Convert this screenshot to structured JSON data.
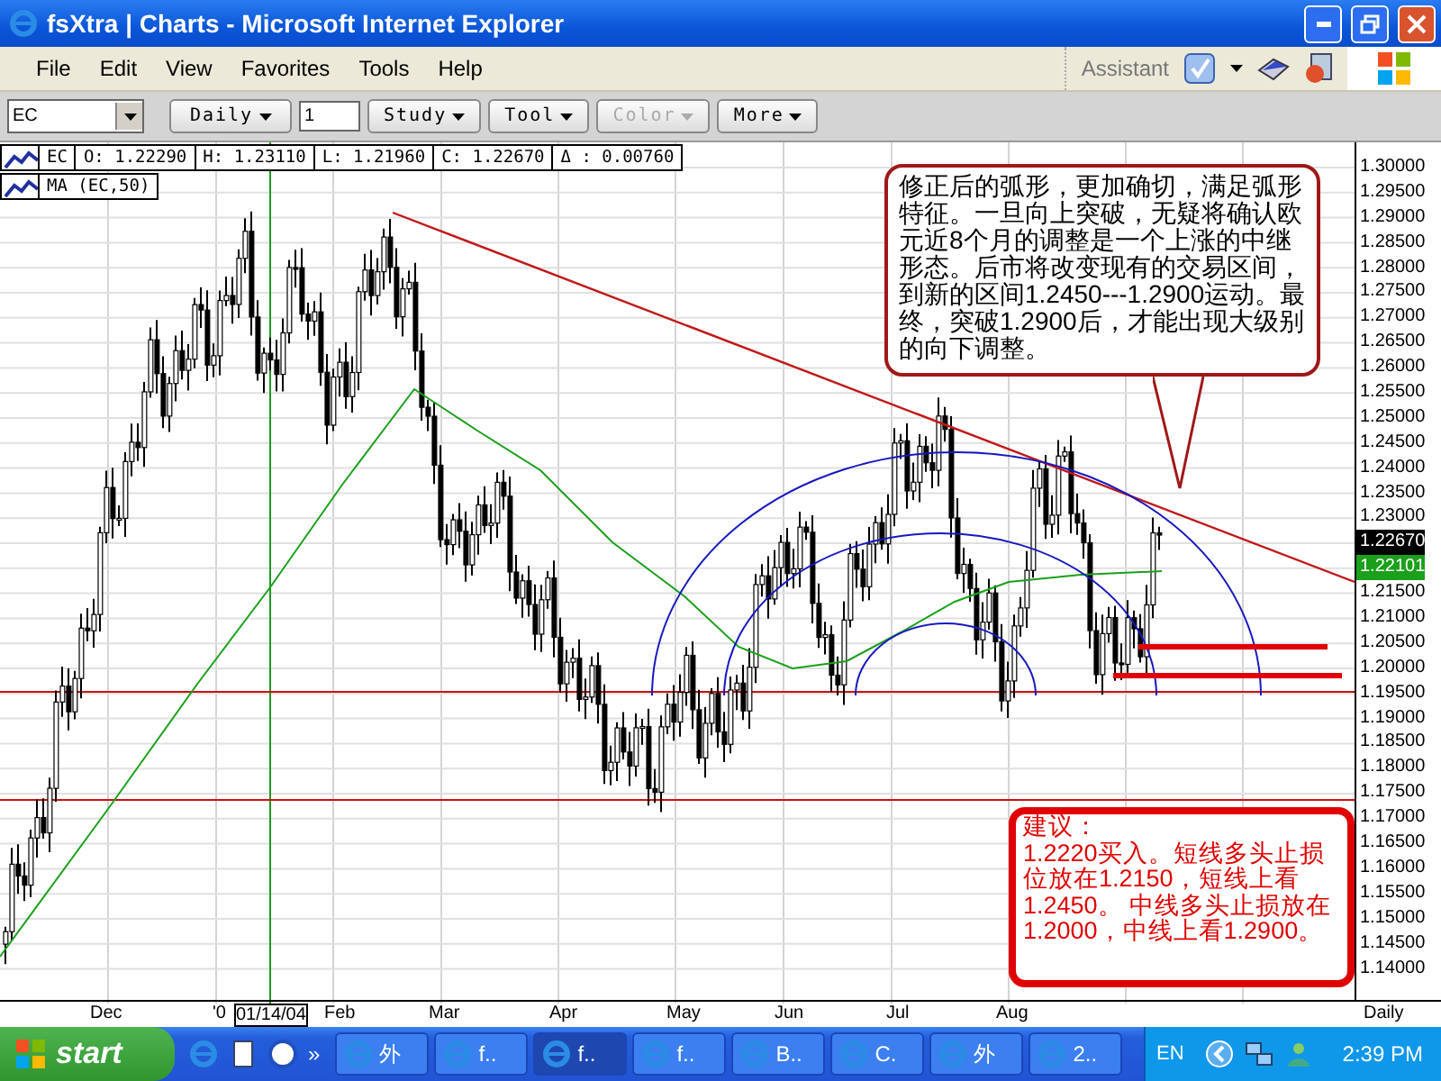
{
  "window": {
    "title": "fsXtra | Charts - Microsoft Internet Explorer"
  },
  "menu": [
    "File",
    "Edit",
    "View",
    "Favorites",
    "Tools",
    "Help"
  ],
  "assistant": {
    "label": "Assistant"
  },
  "toolbar": {
    "symbol": "EC",
    "items": [
      {
        "kind": "dropdown",
        "label": "Daily",
        "disabled": false
      },
      {
        "kind": "input",
        "value": "1"
      },
      {
        "kind": "dropdown",
        "label": "Study",
        "disabled": false
      },
      {
        "kind": "dropdown",
        "label": "Tool",
        "disabled": false
      },
      {
        "kind": "dropdown",
        "label": "Color",
        "disabled": true
      },
      {
        "kind": "dropdown",
        "label": "More",
        "disabled": false
      }
    ]
  },
  "legend": {
    "symbol": "EC",
    "fields": [
      "O: 1.22290",
      "H: 1.23110",
      "L: 1.21960",
      "C: 1.22670",
      "Δ : 0.00760"
    ],
    "study": "MA (EC,50)"
  },
  "y_axis": [
    {
      "text": "1.30000",
      "kind": "tick"
    },
    {
      "text": "1.29500",
      "kind": "tick"
    },
    {
      "text": "1.29000",
      "kind": "tick"
    },
    {
      "text": "1.28500",
      "kind": "tick"
    },
    {
      "text": "1.28000",
      "kind": "tick"
    },
    {
      "text": "1.27500",
      "kind": "tick"
    },
    {
      "text": "1.27000",
      "kind": "tick"
    },
    {
      "text": "1.26500",
      "kind": "tick"
    },
    {
      "text": "1.26000",
      "kind": "tick"
    },
    {
      "text": "1.25500",
      "kind": "tick"
    },
    {
      "text": "1.25000",
      "kind": "tick"
    },
    {
      "text": "1.24500",
      "kind": "tick"
    },
    {
      "text": "1.24000",
      "kind": "tick"
    },
    {
      "text": "1.23500",
      "kind": "tick"
    },
    {
      "text": "1.23000",
      "kind": "tick"
    },
    {
      "text": "1.22670",
      "kind": "last"
    },
    {
      "text": "1.22101",
      "kind": "average"
    },
    {
      "text": "1.21500",
      "kind": "tick"
    },
    {
      "text": "1.21000",
      "kind": "tick"
    },
    {
      "text": "1.20500",
      "kind": "tick"
    },
    {
      "text": "1.20000",
      "kind": "tick"
    },
    {
      "text": "1.19500",
      "kind": "tick"
    },
    {
      "text": "1.19000",
      "kind": "tick"
    },
    {
      "text": "1.18500",
      "kind": "tick"
    },
    {
      "text": "1.18000",
      "kind": "tick"
    },
    {
      "text": "1.17500",
      "kind": "tick"
    },
    {
      "text": "1.17000",
      "kind": "tick"
    },
    {
      "text": "1.16500",
      "kind": "tick"
    },
    {
      "text": "1.16000",
      "kind": "tick"
    },
    {
      "text": "1.15500",
      "kind": "tick"
    },
    {
      "text": "1.15000",
      "kind": "tick"
    },
    {
      "text": "1.14500",
      "kind": "tick"
    },
    {
      "text": "1.14000",
      "kind": "tick"
    }
  ],
  "x_axis": {
    "labels": [
      {
        "text": "Dec",
        "kind": "month"
      },
      {
        "text": "'0",
        "kind": "month"
      },
      {
        "text": "01/14/04",
        "kind": "cursor"
      },
      {
        "text": "Feb",
        "kind": "month"
      },
      {
        "text": "Mar",
        "kind": "month"
      },
      {
        "text": "Apr",
        "kind": "month"
      },
      {
        "text": "May",
        "kind": "month"
      },
      {
        "text": "Jun",
        "kind": "month"
      },
      {
        "text": "Jul",
        "kind": "month"
      },
      {
        "text": "Aug",
        "kind": "month"
      }
    ],
    "interval": "Daily"
  },
  "note": "修正后的弧形，更加确切，满足弧形特征。一旦向上突破，无疑将确认欧元近8个月的调整是一个上涨的中继形态。后市将改变现有的交易区间，到新的区间1.2450---1.2900运动。最终，突破1.2900后，才能出现大级别的向下调整。",
  "advice": {
    "heading": "建议：",
    "body": "1.2220买入。短线多头止损位放在1.2150，短线上看1.2450。 中线多头止损放在1.2000，中线上看1.2900。"
  },
  "taskbar": {
    "start": "start",
    "more": "»",
    "tasks": [
      {
        "label": "外",
        "selected": false
      },
      {
        "label": "f..",
        "selected": false
      },
      {
        "label": "f..",
        "selected": true
      },
      {
        "label": "f..",
        "selected": false
      },
      {
        "label": "B..",
        "selected": false
      },
      {
        "label": "C.",
        "selected": false
      },
      {
        "label": "外",
        "selected": false
      },
      {
        "label": "2..",
        "selected": false
      }
    ],
    "language": "EN",
    "clock": "2:39 PM"
  }
}
